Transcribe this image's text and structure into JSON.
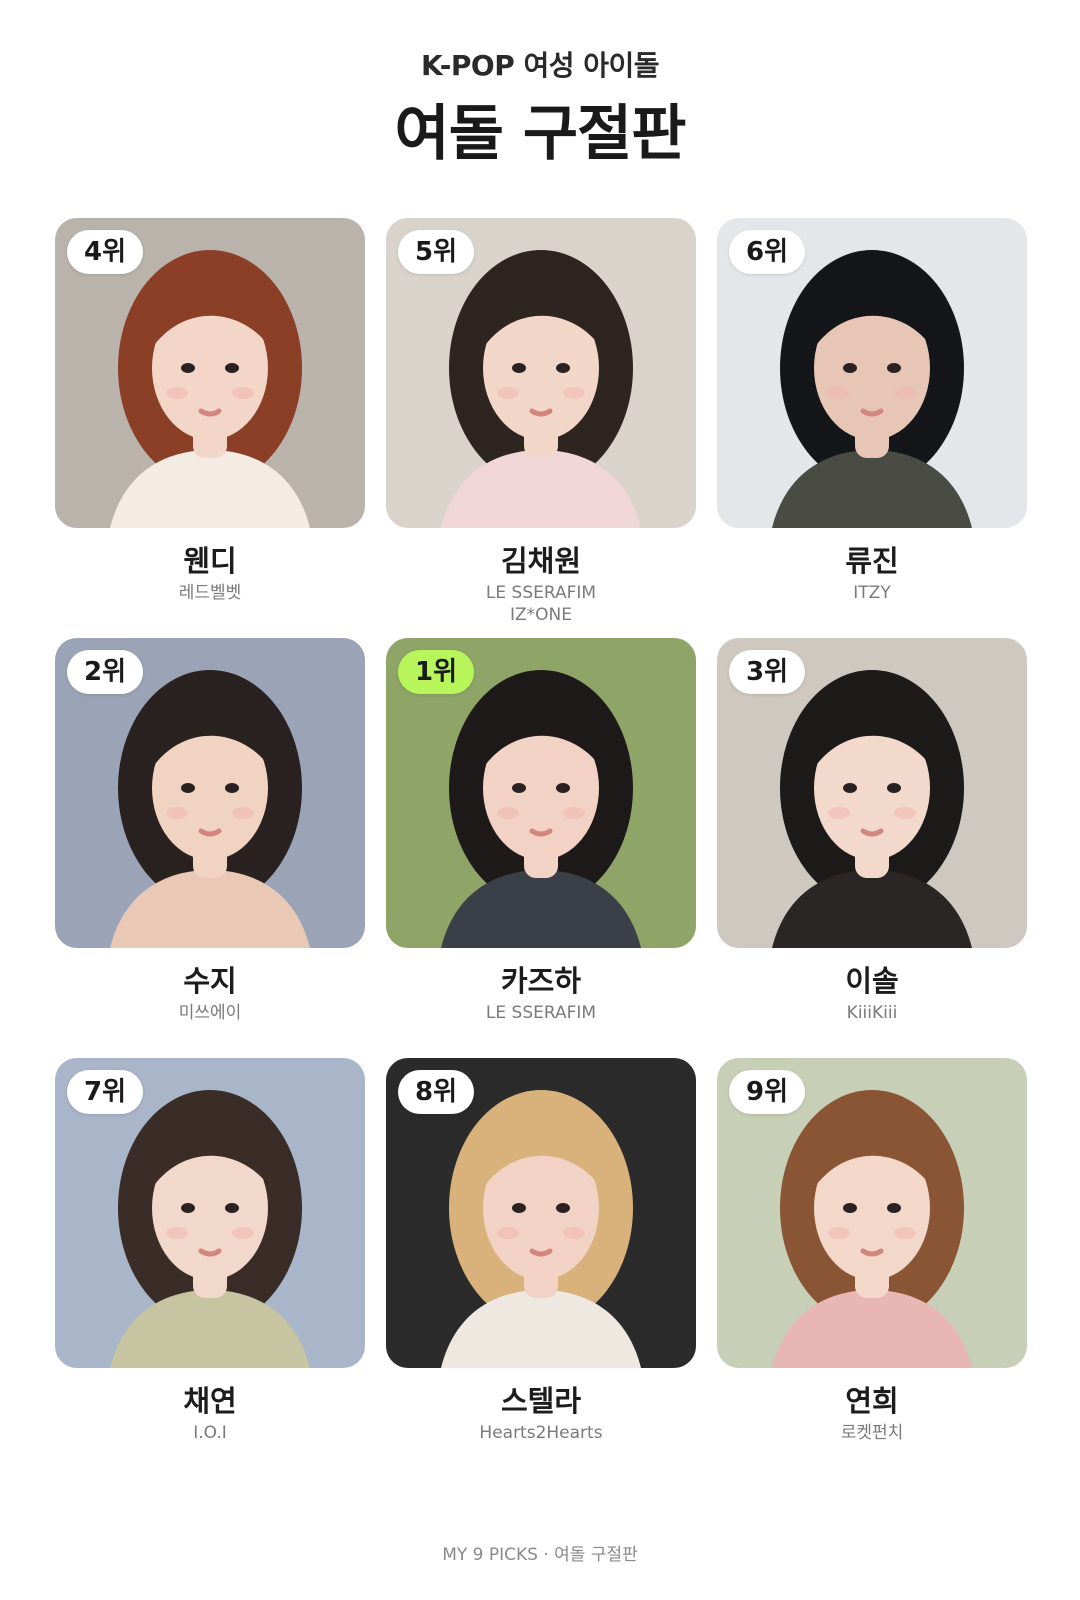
{
  "header": {
    "subtitle": "K-POP 여성 아이돌",
    "title": "여돌 구절판"
  },
  "cards": [
    {
      "rank": "4위",
      "name": "웬디",
      "group": "레드벨벳",
      "highlight": false,
      "bg": "#b9b3ac",
      "hair": "#8a3f26",
      "skin": "#f3d6c8",
      "cloth": "#f4ece4"
    },
    {
      "rank": "5위",
      "name": "김채원",
      "group": "LE SSERAFIM\nIZ*ONE",
      "highlight": false,
      "bg": "#d9d3cc",
      "hair": "#2e2520",
      "skin": "#f2d7c9",
      "cloth": "#f1d6d8"
    },
    {
      "rank": "6위",
      "name": "류진",
      "group": "ITZY",
      "highlight": false,
      "bg": "#e4e6ea",
      "hair": "#15161a",
      "skin": "#e8c6b6",
      "cloth": "#4a4c44"
    },
    {
      "rank": "2위",
      "name": "수지",
      "group": "미쓰에이",
      "highlight": false,
      "bg": "#9aa4b6",
      "hair": "#2a2220",
      "skin": "#f1d3c2",
      "cloth": "#e9c8b6"
    },
    {
      "rank": "1위",
      "name": "카즈하",
      "group": "LE SSERAFIM",
      "highlight": true,
      "bg": "#8ea567",
      "hair": "#1f1a1a",
      "skin": "#f2d2c4",
      "cloth": "#3b3f47"
    },
    {
      "rank": "3위",
      "name": "이솔",
      "group": "KiiiKiii",
      "highlight": false,
      "bg": "#cfc8c0",
      "hair": "#1d1a1a",
      "skin": "#f3d9cc",
      "cloth": "#2a2626"
    },
    {
      "rank": "7위",
      "name": "채연",
      "group": "I.O.I",
      "highlight": false,
      "bg": "#a9b5c8",
      "hair": "#3a2c26",
      "skin": "#f2d8cb",
      "cloth": "#c7c4a2"
    },
    {
      "rank": "8위",
      "name": "스텔라",
      "group": "Hearts2Hearts",
      "highlight": false,
      "bg": "#2c2b2b",
      "hair": "#d8b27a",
      "skin": "#f1d2c4",
      "cloth": "#efe8e0"
    },
    {
      "rank": "9위",
      "name": "연희",
      "group": "로켓펀치",
      "highlight": false,
      "bg": "#c7cfb6",
      "hair": "#8a5534",
      "skin": "#f3d7c8",
      "cloth": "#e8b7b3"
    }
  ],
  "footer": {
    "text": "MY 9 PICKS · 여돌 구절판"
  },
  "colors": {
    "badge_highlight": "#b8f55a",
    "badge_default": "#ffffff"
  }
}
